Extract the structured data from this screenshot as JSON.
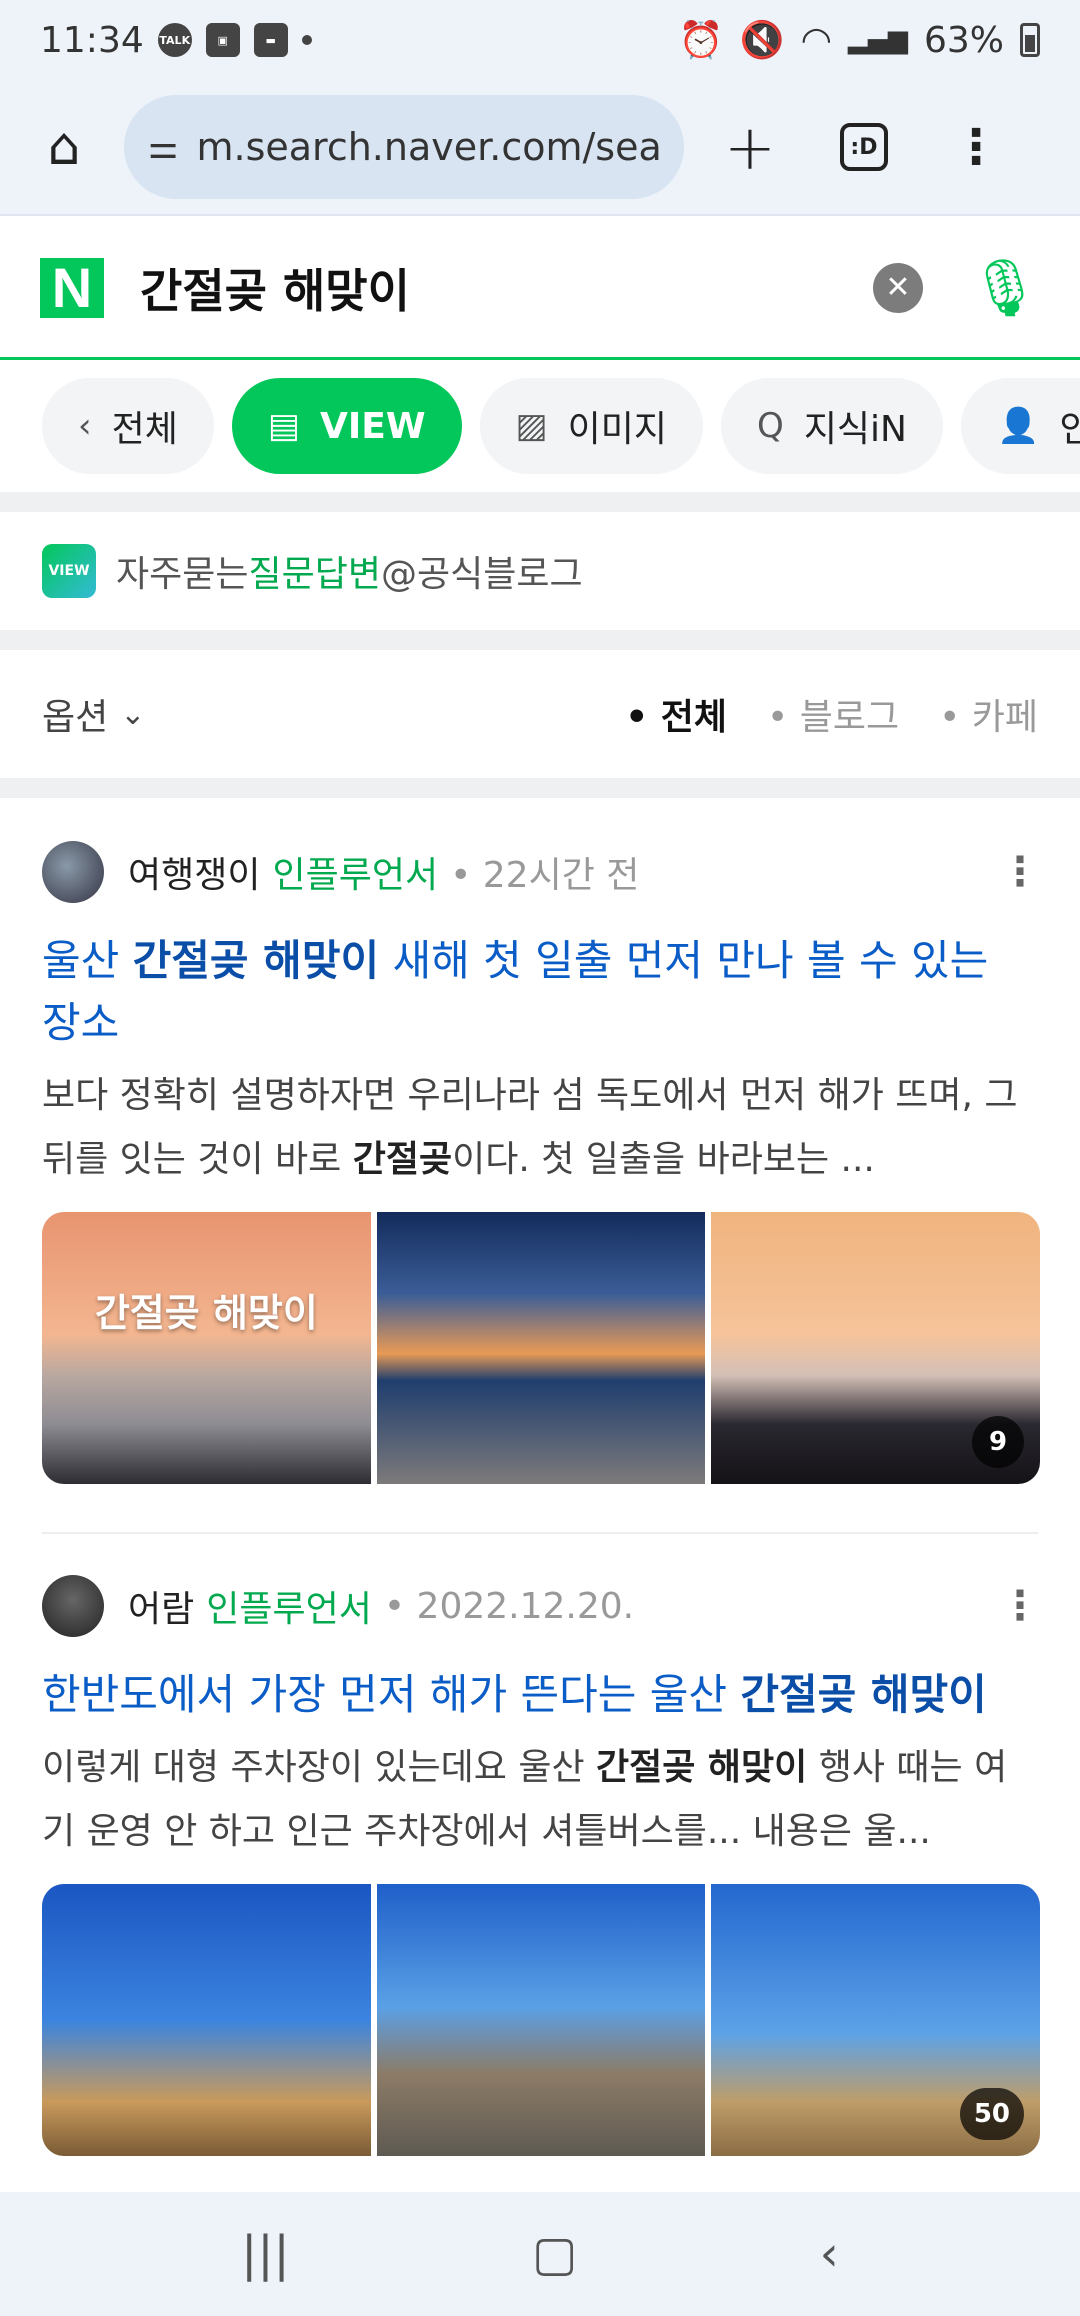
{
  "status_bar": {
    "time": "11:34",
    "notif_icons": [
      "talk-icon",
      "gallery-icon",
      "message-icon"
    ],
    "talk_label": "TALK",
    "battery": "63%"
  },
  "browser": {
    "url": "m.search.naver.com/sea",
    "tabs_label": ":D"
  },
  "search": {
    "logo": "N",
    "query": "간절곶 해맞이"
  },
  "categories": [
    {
      "label": "전체",
      "icon": "chevron-left-icon"
    },
    {
      "label": "VIEW",
      "icon": "doc-icon",
      "active": true
    },
    {
      "label": "이미지",
      "icon": "image-icon"
    },
    {
      "label": "지식iN",
      "icon": "qna-icon"
    },
    {
      "label": "인플루",
      "icon": "person-icon"
    }
  ],
  "faq": {
    "badge": "VIEW",
    "prefix": "자주묻는",
    "highlight": "질문답변",
    "suffix": "@공식블로그"
  },
  "options": {
    "label": "옵션",
    "filters": [
      "• 전체",
      "• 블로그",
      "• 카페"
    ],
    "active_filter": 0
  },
  "posts": [
    {
      "author": "여행쟁이",
      "badge": "인플루언서",
      "time": "• 22시간 전",
      "title_pre": "울산 ",
      "title_bold": "간절곶 해맞이",
      "title_post": " 새해 첫 일출 먼저 만나 볼 수 있는 장소",
      "snippet_pre": "보다 정확히 설명하자면 우리나라 섬 독도에서 먼저 해가 뜨며, 그 뒤를 잇는 것이 바로 ",
      "snippet_bold": "간절곶",
      "snippet_post": "이다. 첫 일출을 바라보는 ...",
      "thumb_overlay": "간절곶 해맞이",
      "image_count": "9"
    },
    {
      "author": "어람",
      "badge": "인플루언서",
      "time": "• 2022.12.20.",
      "title_pre": "한반도에서 가장 먼저 해가 뜬다는 울산 ",
      "title_bold": "간절곶 해맞이",
      "title_post": "",
      "snippet_pre": "이렇게 대형 주차장이 있는데요 울산 ",
      "snippet_bold": "간절곶 해맞이",
      "snippet_post": " 행사 때는 여기 운영 안 하고 인근 주차장에서 셔틀버스를... 내용은 울...",
      "image_count": "50"
    }
  ]
}
